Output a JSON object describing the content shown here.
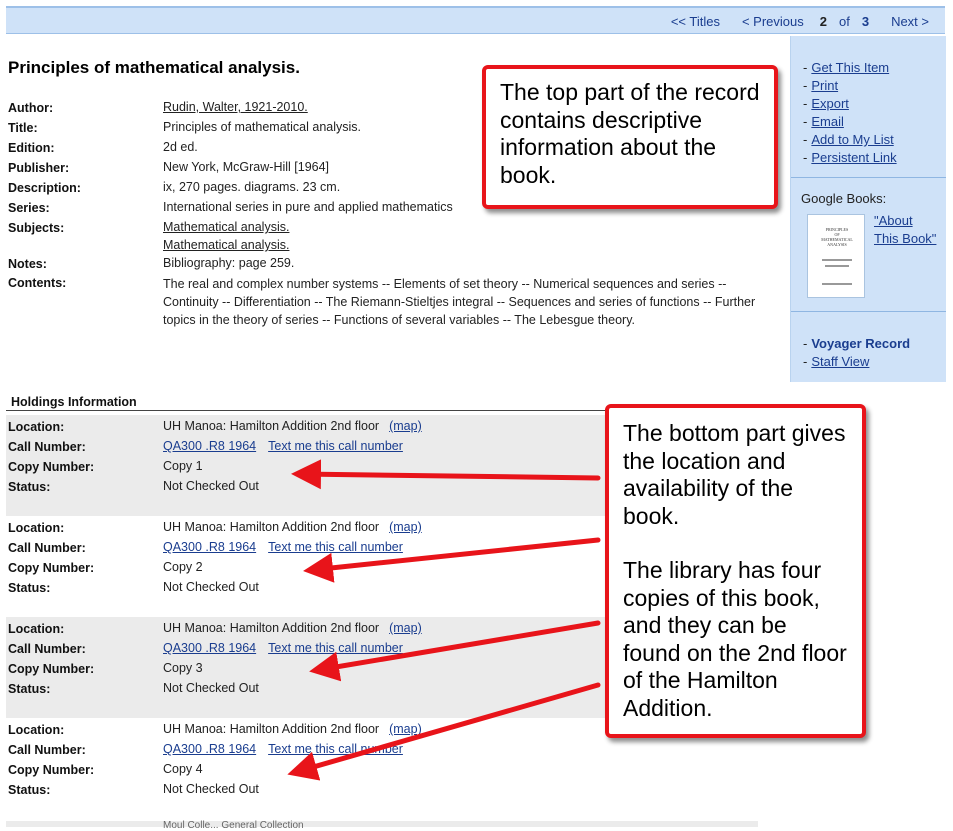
{
  "nav": {
    "titles": "<< Titles",
    "previous": "< Previous",
    "current": "2",
    "of": "of",
    "total": "3",
    "next": "Next >"
  },
  "record": {
    "title": "Principles of mathematical analysis.",
    "fields": [
      {
        "label": "Author:",
        "value": "Rudin, Walter, 1921-2010.",
        "link": true
      },
      {
        "label": "Title:",
        "value": "Principles of mathematical analysis.",
        "link": false
      },
      {
        "label": "Edition:",
        "value": "2d ed.",
        "link": false
      },
      {
        "label": "Publisher:",
        "value": "New York, McGraw-Hill [1964]",
        "link": false
      },
      {
        "label": "Description:",
        "value": "ix, 270 pages. diagrams. 23 cm.",
        "link": false
      },
      {
        "label": "Series:",
        "value": "International series in pure and applied mathematics",
        "link": false
      },
      {
        "label": "Subjects:",
        "value": "Mathematical analysis.",
        "link": true
      },
      {
        "label": "",
        "value": "Mathematical analysis.",
        "link": true
      },
      {
        "label": "Notes:",
        "value": "Bibliography: page 259.",
        "link": false
      }
    ],
    "contents_label": "Contents:",
    "contents": "The real and complex number systems -- Elements of set theory -- Numerical sequences and series -- Continuity -- Differentiation -- The Riemann-Stieltjes integral -- Sequences and series of functions -- Further topics in the theory of series -- Functions of several variables -- The Lebesgue theory."
  },
  "sidebar": {
    "actions": [
      "Get This Item",
      "Print",
      "Export",
      "Email",
      "Add to My List",
      "Persistent Link"
    ],
    "google_books_label": "Google Books:",
    "google_books_link": "\"About This Book\"",
    "voyager_record": "Voyager Record",
    "staff_view": "Staff View"
  },
  "holdings": {
    "title": "Holdings Information",
    "labels": {
      "location": "Location:",
      "call_number": "Call Number:",
      "copy_number": "Copy Number:",
      "status": "Status:"
    },
    "map_label": "(map)",
    "text_me_label": "Text me this call number",
    "copies": [
      {
        "location": "UH Manoa: Hamilton Addition 2nd floor",
        "call_number": "QA300 .R8 1964",
        "copy": "Copy 1",
        "status": "Not Checked Out"
      },
      {
        "location": "UH Manoa: Hamilton Addition 2nd floor",
        "call_number": "QA300 .R8 1964",
        "copy": "Copy 2",
        "status": "Not Checked Out"
      },
      {
        "location": "UH Manoa: Hamilton Addition 2nd floor",
        "call_number": "QA300 .R8 1964",
        "copy": "Copy 3",
        "status": "Not Checked Out"
      },
      {
        "location": "UH Manoa: Hamilton Addition 2nd floor",
        "call_number": "QA300 .R8 1964",
        "copy": "Copy 4",
        "status": "Not Checked Out"
      }
    ],
    "next_partial": "Moul Colle... General Collection"
  },
  "callouts": {
    "top": "The top part of the record contains descriptive information about the book.",
    "bottom_p1": "The bottom part gives the location and availability of the book.",
    "bottom_p2": "The library has four copies of this book, and they can be found on the 2nd floor of the Hamilton Addition."
  },
  "colors": {
    "callout_border": "#e8141a",
    "arrow": "#e8141a",
    "nav_bg": "#cfe2f8",
    "link": "#1a3d8f"
  }
}
